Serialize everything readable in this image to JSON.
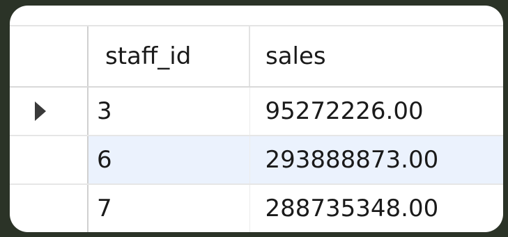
{
  "grid": {
    "columns": [
      "staff_id",
      "sales"
    ],
    "rows": [
      {
        "staff_id": "3",
        "sales": "95272226.00"
      },
      {
        "staff_id": "6",
        "sales": "293888873.00"
      },
      {
        "staff_id": "7",
        "sales": "288735348.00"
      }
    ],
    "current_row_marker": "row-pointer-icon"
  }
}
